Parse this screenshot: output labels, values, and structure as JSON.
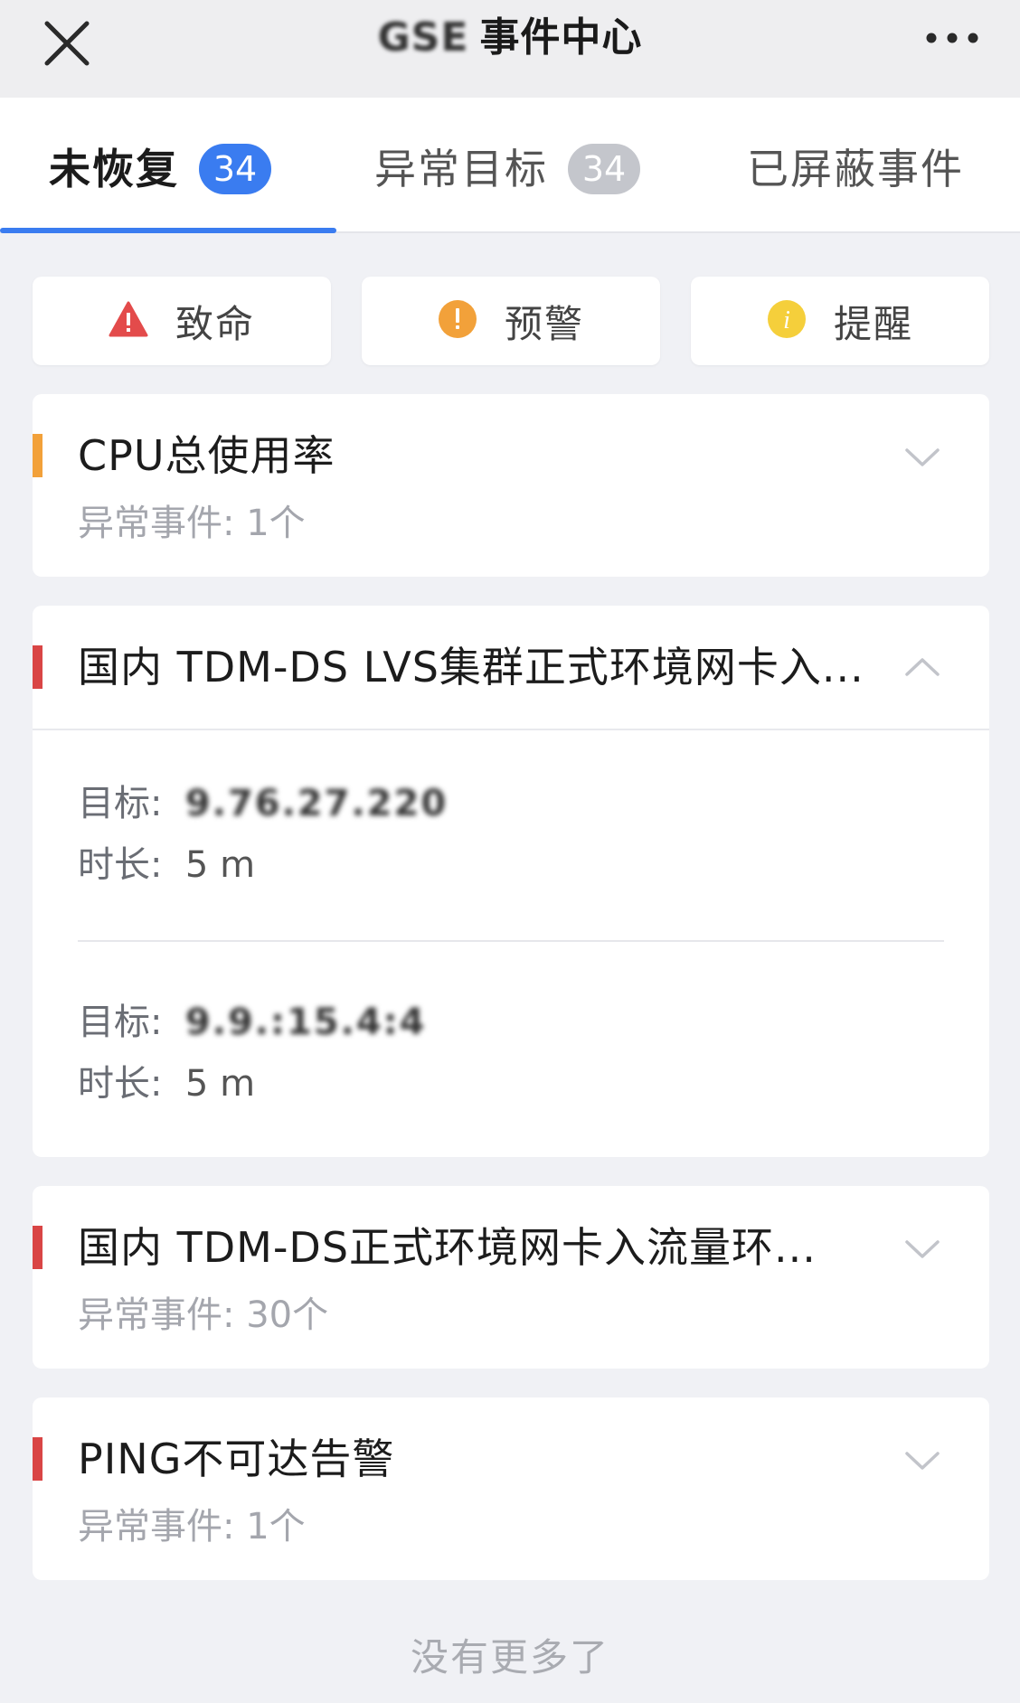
{
  "header": {
    "title_prefix": "GSE",
    "title": "事件中心",
    "close_icon": "close-icon",
    "more_icon": "more-icon"
  },
  "tabs": [
    {
      "label": "未恢复",
      "badge": "34",
      "active": true
    },
    {
      "label": "异常目标",
      "badge": "34",
      "active": false
    },
    {
      "label": "已屏蔽事件",
      "active": false
    }
  ],
  "filters": [
    {
      "label": "致命",
      "icon": "warning-triangle-icon",
      "color": "#e34b4b"
    },
    {
      "label": "预警",
      "icon": "exclamation-circle-icon",
      "color": "#f2a13a"
    },
    {
      "label": "提醒",
      "icon": "info-circle-icon",
      "color": "#f5cf3b"
    }
  ],
  "events": [
    {
      "title": "CPU总使用率",
      "subtitle": "异常事件: 1个",
      "level_color": "#f2a13a",
      "expanded": false
    },
    {
      "title": "国内 TDM-DS LVS集群正式环境网卡入...",
      "level_color": "#d94545",
      "expanded": true,
      "details": [
        {
          "target_label": "目标:",
          "target": "9.76.27.220",
          "duration_label": "时长:",
          "duration": "5 m"
        },
        {
          "target_label": "目标:",
          "target": "9.9.:15.4:4",
          "duration_label": "时长:",
          "duration": "5 m"
        }
      ]
    },
    {
      "title": "国内 TDM-DS正式环境网卡入流量环...",
      "subtitle": "异常事件: 30个",
      "level_color": "#d94545",
      "expanded": false
    },
    {
      "title": "PING不可达告警",
      "subtitle": "异常事件: 1个",
      "level_color": "#d94545",
      "expanded": false
    }
  ],
  "footer": {
    "text": "没有更多了"
  }
}
